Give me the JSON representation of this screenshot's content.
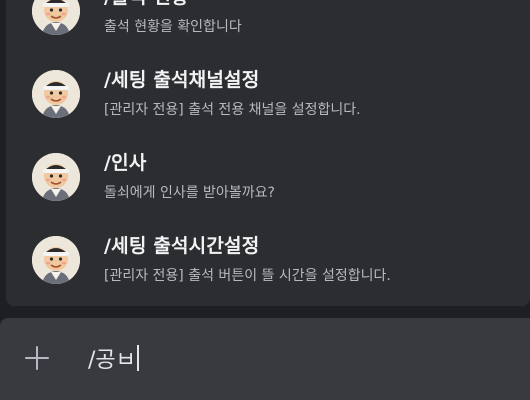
{
  "commands": [
    {
      "name": "/출석 현황",
      "description": "출석 현황을 확인합니다"
    },
    {
      "name": "/세팅 출석채널설정",
      "description": "[관리자 전용] 출석 전용 채널을 설정합니다."
    },
    {
      "name": "/인사",
      "description": "돌쇠에게 인사를 받아볼까요?"
    },
    {
      "name": "/세팅 출석시간설정",
      "description": "[관리자 전용] 출석 버튼이 뜰 시간을 설정합니다."
    }
  ],
  "composer": {
    "icon": "plus-icon",
    "value": "/공ㅂ"
  },
  "colors": {
    "background": "#1e1f22",
    "popup": "#2b2d31",
    "composer": "#383a40",
    "title_text": "#f2f3f5",
    "desc_text": "#b5bac1"
  }
}
